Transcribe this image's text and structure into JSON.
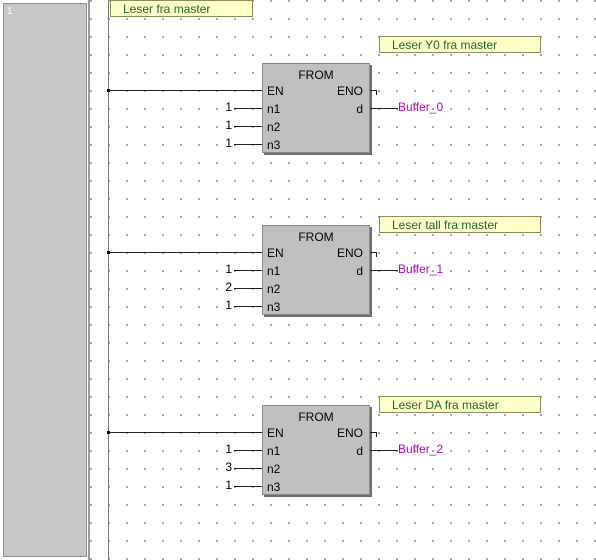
{
  "gutter": {
    "rung_number": "1"
  },
  "header_comment": "Leser fra master",
  "blocks": [
    {
      "comment": "Leser Y0 fra master",
      "function": "FROM",
      "pins": {
        "en": "EN",
        "eno": "ENO",
        "n1": "n1",
        "n2": "n2",
        "n3": "n3",
        "d": "d"
      },
      "inputs": {
        "n1": "1",
        "n2": "1",
        "n3": "1"
      },
      "output": "Buffer_0"
    },
    {
      "comment": "Leser tall fra master",
      "function": "FROM",
      "pins": {
        "en": "EN",
        "eno": "ENO",
        "n1": "n1",
        "n2": "n2",
        "n3": "n3",
        "d": "d"
      },
      "inputs": {
        "n1": "1",
        "n2": "2",
        "n3": "1"
      },
      "output": "Buffer_1"
    },
    {
      "comment": "Leser DA fra master",
      "function": "FROM",
      "pins": {
        "en": "EN",
        "eno": "ENO",
        "n1": "n1",
        "n2": "n2",
        "n3": "n3",
        "d": "d"
      },
      "inputs": {
        "n1": "1",
        "n2": "3",
        "n3": "1"
      },
      "output": "Buffer_2"
    }
  ]
}
